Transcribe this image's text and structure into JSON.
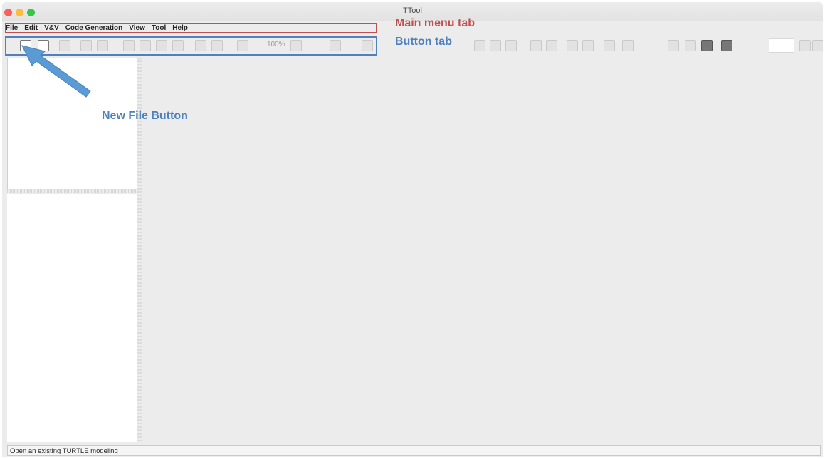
{
  "window": {
    "title": "TTool"
  },
  "menu": [
    "File",
    "Edit",
    "V&V",
    "Code Generation",
    "View",
    "Tool",
    "Help"
  ],
  "toolbar": {
    "zoom": "100%"
  },
  "status": {
    "text": "Open an existing TURTLE modeling"
  },
  "annotations": {
    "main_menu": "Main menu tab",
    "button_tab": "Button tab",
    "new_file": "New File Button",
    "colors": {
      "menu": "#c0504d",
      "buttons": "#4f81bd"
    }
  }
}
